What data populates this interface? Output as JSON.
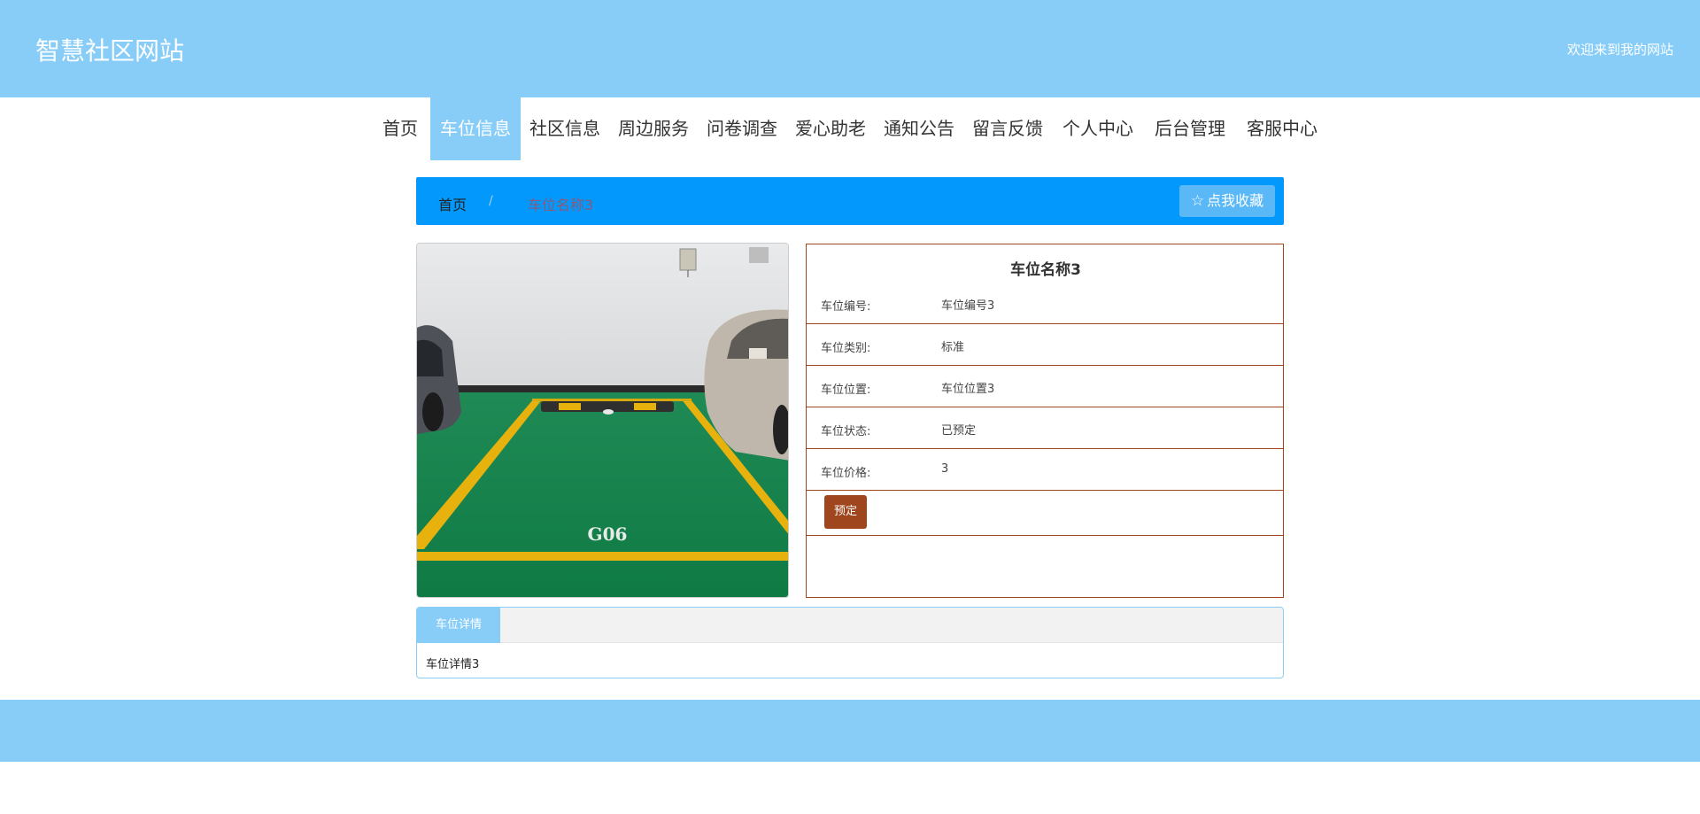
{
  "header": {
    "site_title": "智慧社区网站",
    "welcome": "欢迎来到我的网站"
  },
  "nav": {
    "items": [
      "首页",
      "车位信息",
      "社区信息",
      "周边服务",
      "问卷调查",
      "爱心助老",
      "通知公告",
      "留言反馈",
      "个人中心",
      "后台管理",
      "客服中心"
    ],
    "active_index": 1
  },
  "breadcrumb": {
    "home": "首页",
    "separator": "/",
    "current": "车位名称3"
  },
  "favorite_button": {
    "label": "点我收藏",
    "icon": "star-outline-icon"
  },
  "photo": {
    "description_icon": "parking-space-photo",
    "marking": "G06"
  },
  "detail": {
    "title": "车位名称3",
    "fields": [
      {
        "label": "车位编号:",
        "value": "车位编号3"
      },
      {
        "label": "车位类别:",
        "value": "标准"
      },
      {
        "label": "车位位置:",
        "value": "车位位置3"
      },
      {
        "label": "车位状态:",
        "value": "已预定"
      },
      {
        "label": "车位价格:",
        "value": "3"
      }
    ],
    "book_button": "预定"
  },
  "tabs": {
    "active_label": "车位详情",
    "content": "车位详情3"
  },
  "colors": {
    "header_bg": "#87cdf8",
    "breadcrumb_bg": "#0398fc",
    "accent_brown": "#a0461e"
  }
}
